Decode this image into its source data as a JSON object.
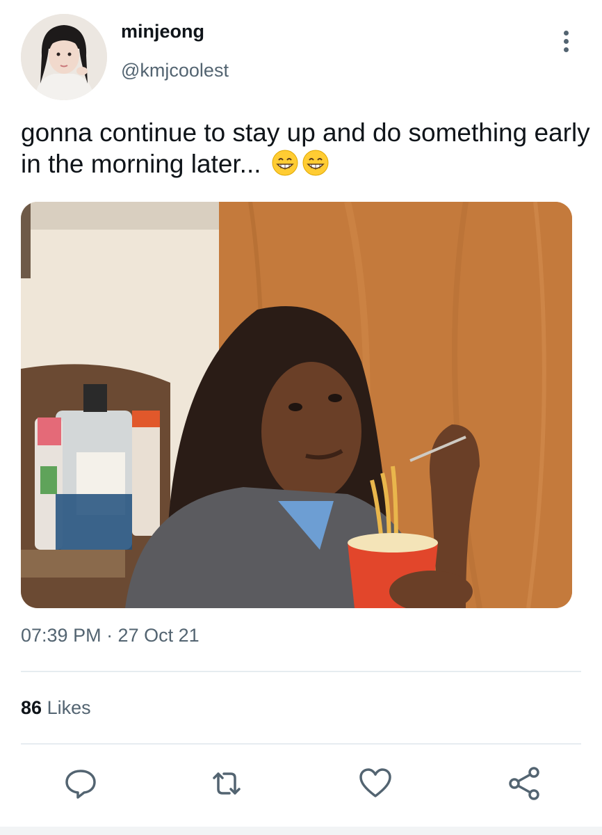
{
  "tweet": {
    "author": {
      "display_name": "minjeong",
      "handle": "@kmjcoolest",
      "avatar_icon": "profile-photo"
    },
    "text": "gonna continue to stay up and do something early in the morning later...",
    "emojis": [
      "grinning-face-with-smiling-eyes",
      "grinning-face-with-smiling-eyes"
    ],
    "media": {
      "type": "photo",
      "alt_icon": "meme-photo"
    },
    "timestamp": "07:39 PM · 27 Oct 21",
    "likes": {
      "count": "86",
      "label": "Likes"
    },
    "actions": [
      {
        "name": "reply",
        "icon": "speech-bubble-icon"
      },
      {
        "name": "retweet",
        "icon": "retweet-icon"
      },
      {
        "name": "like",
        "icon": "heart-icon"
      },
      {
        "name": "share",
        "icon": "share-icon"
      }
    ]
  },
  "colors": {
    "text_primary": "#0f1419",
    "text_secondary": "#536471",
    "divider": "#e6ecf0",
    "icon": "#536471"
  }
}
